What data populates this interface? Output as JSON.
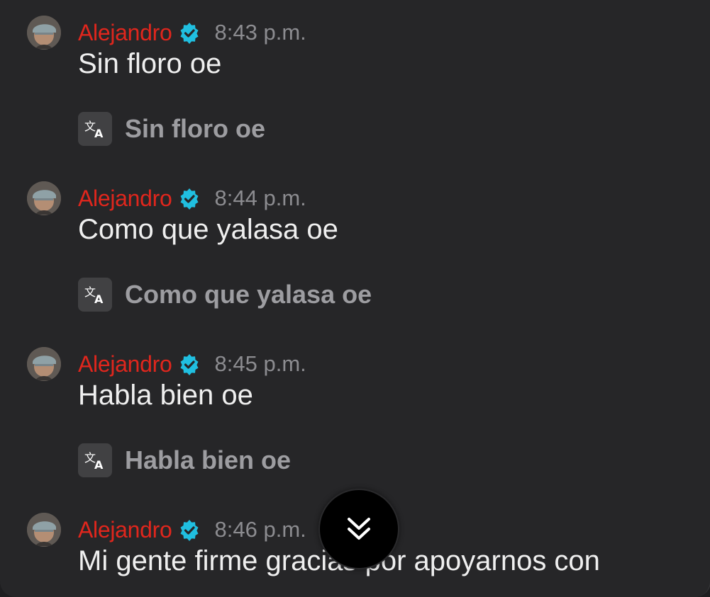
{
  "messages": [
    {
      "author": "Alejandro",
      "time": "8:43 p.m.",
      "text": "Sin floro oe",
      "translation": "Sin floro oe"
    },
    {
      "author": "Alejandro",
      "time": "8:44 p.m.",
      "text": "Como que yalasa oe",
      "translation": "Como que yalasa oe"
    },
    {
      "author": "Alejandro",
      "time": "8:45 p.m.",
      "text": "Habla bien oe",
      "translation": "Habla bien oe"
    },
    {
      "author": "Alejandro",
      "time": "8:46 p.m.",
      "text": "Mi gente firme gracias por apoyarnos con",
      "translation": ""
    }
  ],
  "icons": {
    "verified": "verified-badge-icon",
    "translate": "translate-icon",
    "scroll_down": "double-chevron-down-icon"
  },
  "colors": {
    "background": "#262628",
    "author": "#e0261d",
    "verified": "#20bfe0",
    "time": "#8c8c90",
    "message_text": "#efefef",
    "translation_text": "#9d9da1",
    "scroll_button": "#000000"
  }
}
